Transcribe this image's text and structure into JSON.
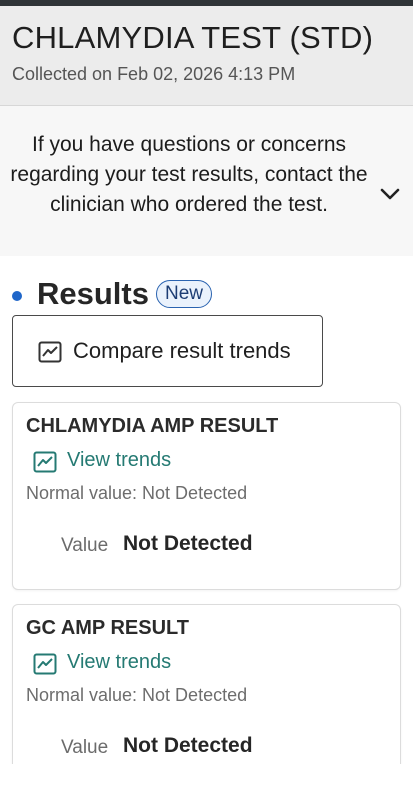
{
  "header": {
    "title": "CHLAMYDIA TEST (STD)",
    "collected": "Collected on Feb 02, 2026 4:13 PM"
  },
  "notice": {
    "text": "If you have questions or concerns regarding your test results, contact the clinician who ordered the test.",
    "toggle_icon": "chevron-down-icon"
  },
  "results": {
    "heading": "Results",
    "badge": "New",
    "compare_label": "Compare result trends",
    "compare_icon": "trend-chart-icon"
  },
  "cards": [
    {
      "title": "CHLAMYDIA AMP RESULT",
      "trend_label": "View trends",
      "normal": "Normal value: Not Detected",
      "value_label": "Value",
      "value": "Not Detected"
    },
    {
      "title": "GC AMP RESULT",
      "trend_label": "View trends",
      "normal": "Normal value: Not Detected",
      "value_label": "Value",
      "value": "Not Detected"
    }
  ],
  "colors": {
    "accent_blue": "#1f66c9",
    "link_teal": "#257a73",
    "header_bg": "#ececec"
  }
}
